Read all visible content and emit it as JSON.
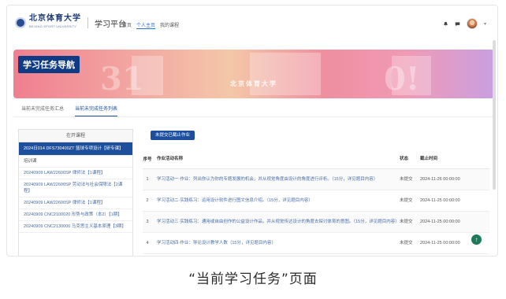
{
  "header": {
    "logo_text": "北京体育大学",
    "logo_sub": "BEIJING SPORT UNIVERSITY",
    "platform": "学习平台",
    "nav": [
      "首页",
      "个人主页",
      "我的课程"
    ],
    "active_nav_index": 1
  },
  "banner": {
    "title": "学习任务导航",
    "center_text": "北京体育大学"
  },
  "tabs": [
    "当前未完成任务汇总",
    "当前未完成任务列表"
  ],
  "active_tab_index": 1,
  "sidebar": {
    "header": "在开课程",
    "items": [
      "2024日014 DFS730400ZT 篮球专项设计【研专课】",
      "培训课",
      "20240909 LAW22600SP 律师法【1课程】",
      "20240909 LAW22600SP 劳动法与社会保障法【2课程】",
      "20240909 LAW22600SP 律师法【1课程】",
      "20240909 CNC2100020 形势与政策（本2）【1期】",
      "20240909 CNC2130000 马克思主义基本原理【3期】"
    ]
  },
  "main": {
    "action_button": "未提交已截止作业",
    "columns": {
      "no": "序号",
      "name": "作业活动名称",
      "status": "状态",
      "due": "截止时间"
    },
    "rows": [
      {
        "no": "1",
        "name": "学习活动一·作业：列出你认为你的专题发展的机会，并从视觉角度由设计的角度进行评析。（15分，详见题目内容）",
        "status": "未提交",
        "due": "2024-11-26 00:00:00"
      },
      {
        "no": "2",
        "name": "学习活动二·实践练习：运用设计软件进行图文信息介绍。（15分，详见题目内容）",
        "status": "未提交",
        "due": "2024-11-25 00:00:00"
      },
      {
        "no": "3",
        "name": "学习活动三·实践练习：通用或自由创作的公益设计作品，并从视觉传达设计的角度去探讨体育的意图。（15分，详见题目内容）",
        "status": "未提交",
        "due": "2024-11-25 00:00:00"
      },
      {
        "no": "4",
        "name": "学习活动四·作业：导论设计教学人数（15分，详见题目内容）",
        "status": "未提交",
        "due": "2024-11-25 00:00:00"
      }
    ]
  },
  "caption": "“当前学习任务”页面",
  "colors": {
    "brand": "#1d4f9c",
    "fab": "#1f7a5c"
  }
}
